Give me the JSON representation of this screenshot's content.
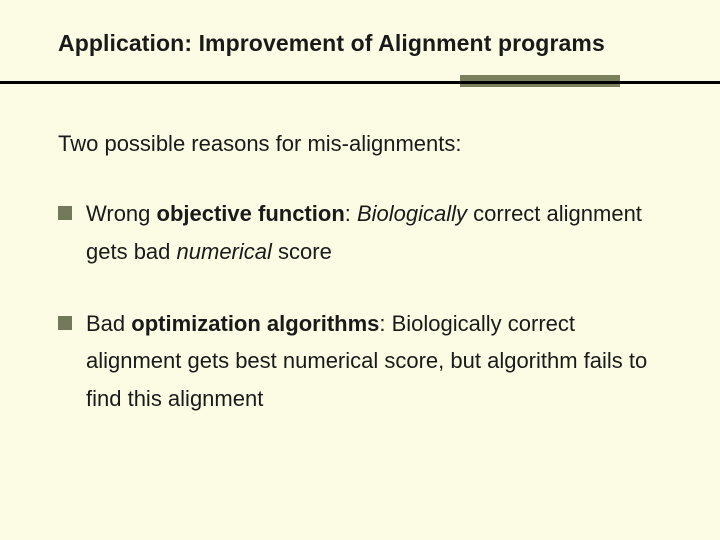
{
  "slide": {
    "title": "Application: Improvement of Alignment programs",
    "intro": "Two possible reasons for mis-alignments:",
    "bullets": [
      {
        "lead_word": "Wrong ",
        "bold_term": "objective function",
        "after_term": ": ",
        "em1": "Biologically",
        "mid1": " correct alignment gets bad ",
        "em2": "numerical",
        "tail": " score"
      },
      {
        "lead_word": "Bad ",
        "bold_term": "optimization algorithms",
        "after_term": ": Biologically correct alignment gets best numerical score, but algorithm fails to find this alignment",
        "em1": "",
        "mid1": "",
        "em2": "",
        "tail": ""
      }
    ]
  }
}
